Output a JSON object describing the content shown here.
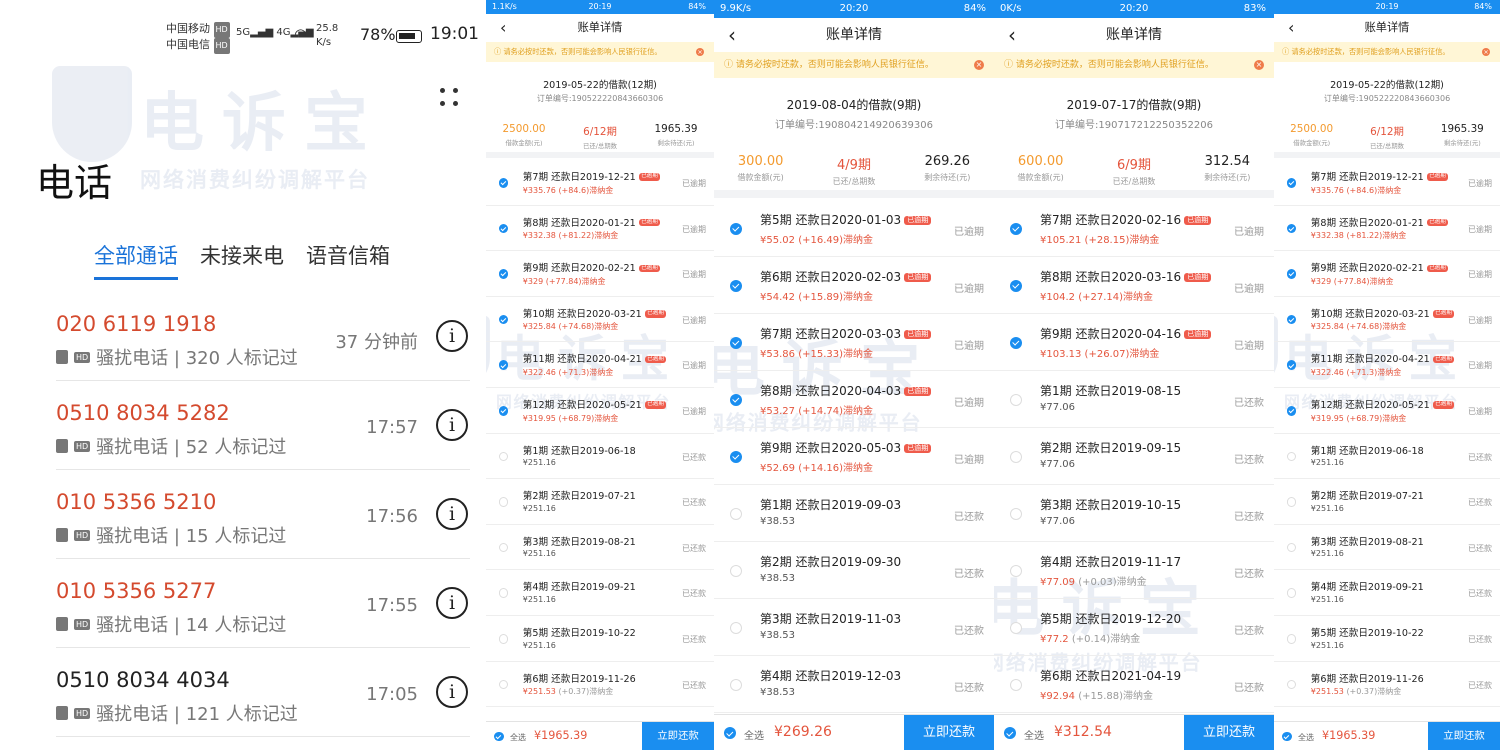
{
  "watermark": {
    "big": "电诉宝",
    "small": "网络消费纠纷调解平台"
  },
  "phone": {
    "status": {
      "carrier1": "中国移动",
      "carrier2": "中国电信",
      "hd": "HD",
      "net1": "5G",
      "net2": "4G",
      "speed": "25.8 K/s",
      "battery": "78%",
      "time": "19:01"
    },
    "title": "电话",
    "tabs": [
      "全部通话",
      "未接来电",
      "语音信箱"
    ],
    "calls": [
      {
        "number": "020 6119 1918",
        "tag": "骚扰电话 | 320 人标记过",
        "time": "37 分钟前",
        "color": "red"
      },
      {
        "number": "0510 8034 5282",
        "tag": "骚扰电话 | 52 人标记过",
        "time": "17:57",
        "color": "red"
      },
      {
        "number": "010 5356 5210",
        "tag": "骚扰电话 | 15 人标记过",
        "time": "17:56",
        "color": "red"
      },
      {
        "number": "010 5356 5277",
        "tag": "骚扰电话 | 14 人标记过",
        "time": "17:55",
        "color": "red"
      },
      {
        "number": "0510 8034 4034",
        "tag": "骚扰电话 | 121 人标记过",
        "time": "17:05",
        "color": "black"
      }
    ]
  },
  "bill_common": {
    "nav_title": "账单详情",
    "notice": "请务必按时还款，否则可能会影响人民银行征信。",
    "stat_labels": [
      "借款金额(元)",
      "已还/总期数",
      "剩余待还(元)"
    ],
    "overdue_tag": "已逾期",
    "status_overdue": "已逾期",
    "status_paid": "已还款",
    "select_all": "全选",
    "pay_button": "立即还款"
  },
  "bills": [
    {
      "status": {
        "left": "1.1K/s",
        "time": "20:19",
        "right": "84%"
      },
      "title": "2019-05-22的借款(12期)",
      "order": "订单编号:190522220843660306",
      "stats": [
        "2500.00",
        "6/12期",
        "1965.39"
      ],
      "items": [
        {
          "checked": true,
          "title": "第7期 还款日2019-12-21",
          "amount": "¥335.76",
          "fee": "(+84.6)滞纳金",
          "overdue": true,
          "status": "已逾期"
        },
        {
          "checked": true,
          "title": "第8期 还款日2020-01-21",
          "amount": "¥332.38",
          "fee": "(+81.22)滞纳金",
          "overdue": true,
          "status": "已逾期"
        },
        {
          "checked": true,
          "title": "第9期 还款日2020-02-21",
          "amount": "¥329",
          "fee": "(+77.84)滞纳金",
          "overdue": true,
          "status": "已逾期"
        },
        {
          "checked": true,
          "title": "第10期 还款日2020-03-21",
          "amount": "¥325.84",
          "fee": "(+74.68)滞纳金",
          "overdue": true,
          "status": "已逾期"
        },
        {
          "checked": true,
          "title": "第11期 还款日2020-04-21",
          "amount": "¥322.46",
          "fee": "(+71.3)滞纳金",
          "overdue": true,
          "status": "已逾期"
        },
        {
          "checked": true,
          "title": "第12期 还款日2020-05-21",
          "amount": "¥319.95",
          "fee": "(+68.79)滞纳金",
          "overdue": true,
          "status": "已逾期"
        },
        {
          "checked": false,
          "title": "第1期 还款日2019-06-18",
          "amount": "¥251.16",
          "fee": "",
          "overdue": false,
          "status": "已还款"
        },
        {
          "checked": false,
          "title": "第2期 还款日2019-07-21",
          "amount": "¥251.16",
          "fee": "",
          "overdue": false,
          "status": "已还款"
        },
        {
          "checked": false,
          "title": "第3期 还款日2019-08-21",
          "amount": "¥251.16",
          "fee": "",
          "overdue": false,
          "status": "已还款"
        },
        {
          "checked": false,
          "title": "第4期 还款日2019-09-21",
          "amount": "¥251.16",
          "fee": "",
          "overdue": false,
          "status": "已还款"
        },
        {
          "checked": false,
          "title": "第5期 还款日2019-10-22",
          "amount": "¥251.16",
          "fee": "",
          "overdue": false,
          "status": "已还款"
        },
        {
          "checked": false,
          "title": "第6期 还款日2019-11-26",
          "amount": "¥251.53",
          "fee": "(+0.37)滞纳金",
          "overdue": false,
          "status": "已还款"
        }
      ],
      "total": "¥1965.39"
    },
    {
      "status": {
        "left": "9.9K/s",
        "time": "20:20",
        "right": "84%"
      },
      "title": "2019-08-04的借款(9期)",
      "order": "订单编号:190804214920639306",
      "stats": [
        "300.00",
        "4/9期",
        "269.26"
      ],
      "items": [
        {
          "checked": true,
          "title": "第5期 还款日2020-01-03",
          "amount": "¥55.02",
          "fee": "(+16.49)滞纳金",
          "overdue": true,
          "status": "已逾期"
        },
        {
          "checked": true,
          "title": "第6期 还款日2020-02-03",
          "amount": "¥54.42",
          "fee": "(+15.89)滞纳金",
          "overdue": true,
          "status": "已逾期"
        },
        {
          "checked": true,
          "title": "第7期 还款日2020-03-03",
          "amount": "¥53.86",
          "fee": "(+15.33)滞纳金",
          "overdue": true,
          "status": "已逾期"
        },
        {
          "checked": true,
          "title": "第8期 还款日2020-04-03",
          "amount": "¥53.27",
          "fee": "(+14.74)滞纳金",
          "overdue": true,
          "status": "已逾期"
        },
        {
          "checked": true,
          "title": "第9期 还款日2020-05-03",
          "amount": "¥52.69",
          "fee": "(+14.16)滞纳金",
          "overdue": true,
          "status": "已逾期"
        },
        {
          "checked": false,
          "title": "第1期 还款日2019-09-03",
          "amount": "¥38.53",
          "fee": "",
          "overdue": false,
          "status": "已还款"
        },
        {
          "checked": false,
          "title": "第2期 还款日2019-09-30",
          "amount": "¥38.53",
          "fee": "",
          "overdue": false,
          "status": "已还款"
        },
        {
          "checked": false,
          "title": "第3期 还款日2019-11-03",
          "amount": "¥38.53",
          "fee": "",
          "overdue": false,
          "status": "已还款"
        },
        {
          "checked": false,
          "title": "第4期 还款日2019-12-03",
          "amount": "¥38.53",
          "fee": "",
          "overdue": false,
          "status": "已还款"
        }
      ],
      "total": "¥269.26"
    },
    {
      "status": {
        "left": "0K/s",
        "time": "20:20",
        "right": "83%"
      },
      "title": "2019-07-17的借款(9期)",
      "order": "订单编号:190717212250352206",
      "stats": [
        "600.00",
        "6/9期",
        "312.54"
      ],
      "items": [
        {
          "checked": true,
          "title": "第7期 还款日2020-02-16",
          "amount": "¥105.21",
          "fee": "(+28.15)滞纳金",
          "overdue": true,
          "status": "已逾期"
        },
        {
          "checked": true,
          "title": "第8期 还款日2020-03-16",
          "amount": "¥104.2",
          "fee": "(+27.14)滞纳金",
          "overdue": true,
          "status": "已逾期"
        },
        {
          "checked": true,
          "title": "第9期 还款日2020-04-16",
          "amount": "¥103.13",
          "fee": "(+26.07)滞纳金",
          "overdue": true,
          "status": "已逾期"
        },
        {
          "checked": false,
          "title": "第1期 还款日2019-08-15",
          "amount": "¥77.06",
          "fee": "",
          "overdue": false,
          "status": "已还款"
        },
        {
          "checked": false,
          "title": "第2期 还款日2019-09-15",
          "amount": "¥77.06",
          "fee": "",
          "overdue": false,
          "status": "已还款"
        },
        {
          "checked": false,
          "title": "第3期 还款日2019-10-15",
          "amount": "¥77.06",
          "fee": "",
          "overdue": false,
          "status": "已还款"
        },
        {
          "checked": false,
          "title": "第4期 还款日2019-11-17",
          "amount": "¥77.09",
          "fee": "(+0.03)滞纳金",
          "overdue": false,
          "status": "已还款"
        },
        {
          "checked": false,
          "title": "第5期 还款日2019-12-20",
          "amount": "¥77.2",
          "fee": "(+0.14)滞纳金",
          "overdue": false,
          "status": "已还款"
        },
        {
          "checked": false,
          "title": "第6期 还款日2021-04-19",
          "amount": "¥92.94",
          "fee": "(+15.88)滞纳金",
          "overdue": false,
          "status": "已还款"
        }
      ],
      "total": "¥312.54"
    },
    {
      "status": {
        "left": "",
        "time": "20:19",
        "right": "84%"
      },
      "title": "2019-05-22的借款(12期)",
      "order": "订单编号:190522220843660306",
      "stats": [
        "2500.00",
        "6/12期",
        "1965.39"
      ],
      "items": [
        {
          "checked": true,
          "title": "第7期 还款日2019-12-21",
          "amount": "¥335.76",
          "fee": "(+84.6)滞纳金",
          "overdue": true,
          "status": "已逾期"
        },
        {
          "checked": true,
          "title": "第8期 还款日2020-01-21",
          "amount": "¥332.38",
          "fee": "(+81.22)滞纳金",
          "overdue": true,
          "status": "已逾期"
        },
        {
          "checked": true,
          "title": "第9期 还款日2020-02-21",
          "amount": "¥329",
          "fee": "(+77.84)滞纳金",
          "overdue": true,
          "status": "已逾期"
        },
        {
          "checked": true,
          "title": "第10期 还款日2020-03-21",
          "amount": "¥325.84",
          "fee": "(+74.68)滞纳金",
          "overdue": true,
          "status": "已逾期"
        },
        {
          "checked": true,
          "title": "第11期 还款日2020-04-21",
          "amount": "¥322.46",
          "fee": "(+71.3)滞纳金",
          "overdue": true,
          "status": "已逾期"
        },
        {
          "checked": true,
          "title": "第12期 还款日2020-05-21",
          "amount": "¥319.95",
          "fee": "(+68.79)滞纳金",
          "overdue": true,
          "status": "已逾期"
        },
        {
          "checked": false,
          "title": "第1期 还款日2019-06-18",
          "amount": "¥251.16",
          "fee": "",
          "overdue": false,
          "status": "已还款"
        },
        {
          "checked": false,
          "title": "第2期 还款日2019-07-21",
          "amount": "¥251.16",
          "fee": "",
          "overdue": false,
          "status": "已还款"
        },
        {
          "checked": false,
          "title": "第3期 还款日2019-08-21",
          "amount": "¥251.16",
          "fee": "",
          "overdue": false,
          "status": "已还款"
        },
        {
          "checked": false,
          "title": "第4期 还款日2019-09-21",
          "amount": "¥251.16",
          "fee": "",
          "overdue": false,
          "status": "已还款"
        },
        {
          "checked": false,
          "title": "第5期 还款日2019-10-22",
          "amount": "¥251.16",
          "fee": "",
          "overdue": false,
          "status": "已还款"
        },
        {
          "checked": false,
          "title": "第6期 还款日2019-11-26",
          "amount": "¥251.53",
          "fee": "(+0.37)滞纳金",
          "overdue": false,
          "status": "已还款"
        }
      ],
      "total": "¥1965.39"
    }
  ]
}
